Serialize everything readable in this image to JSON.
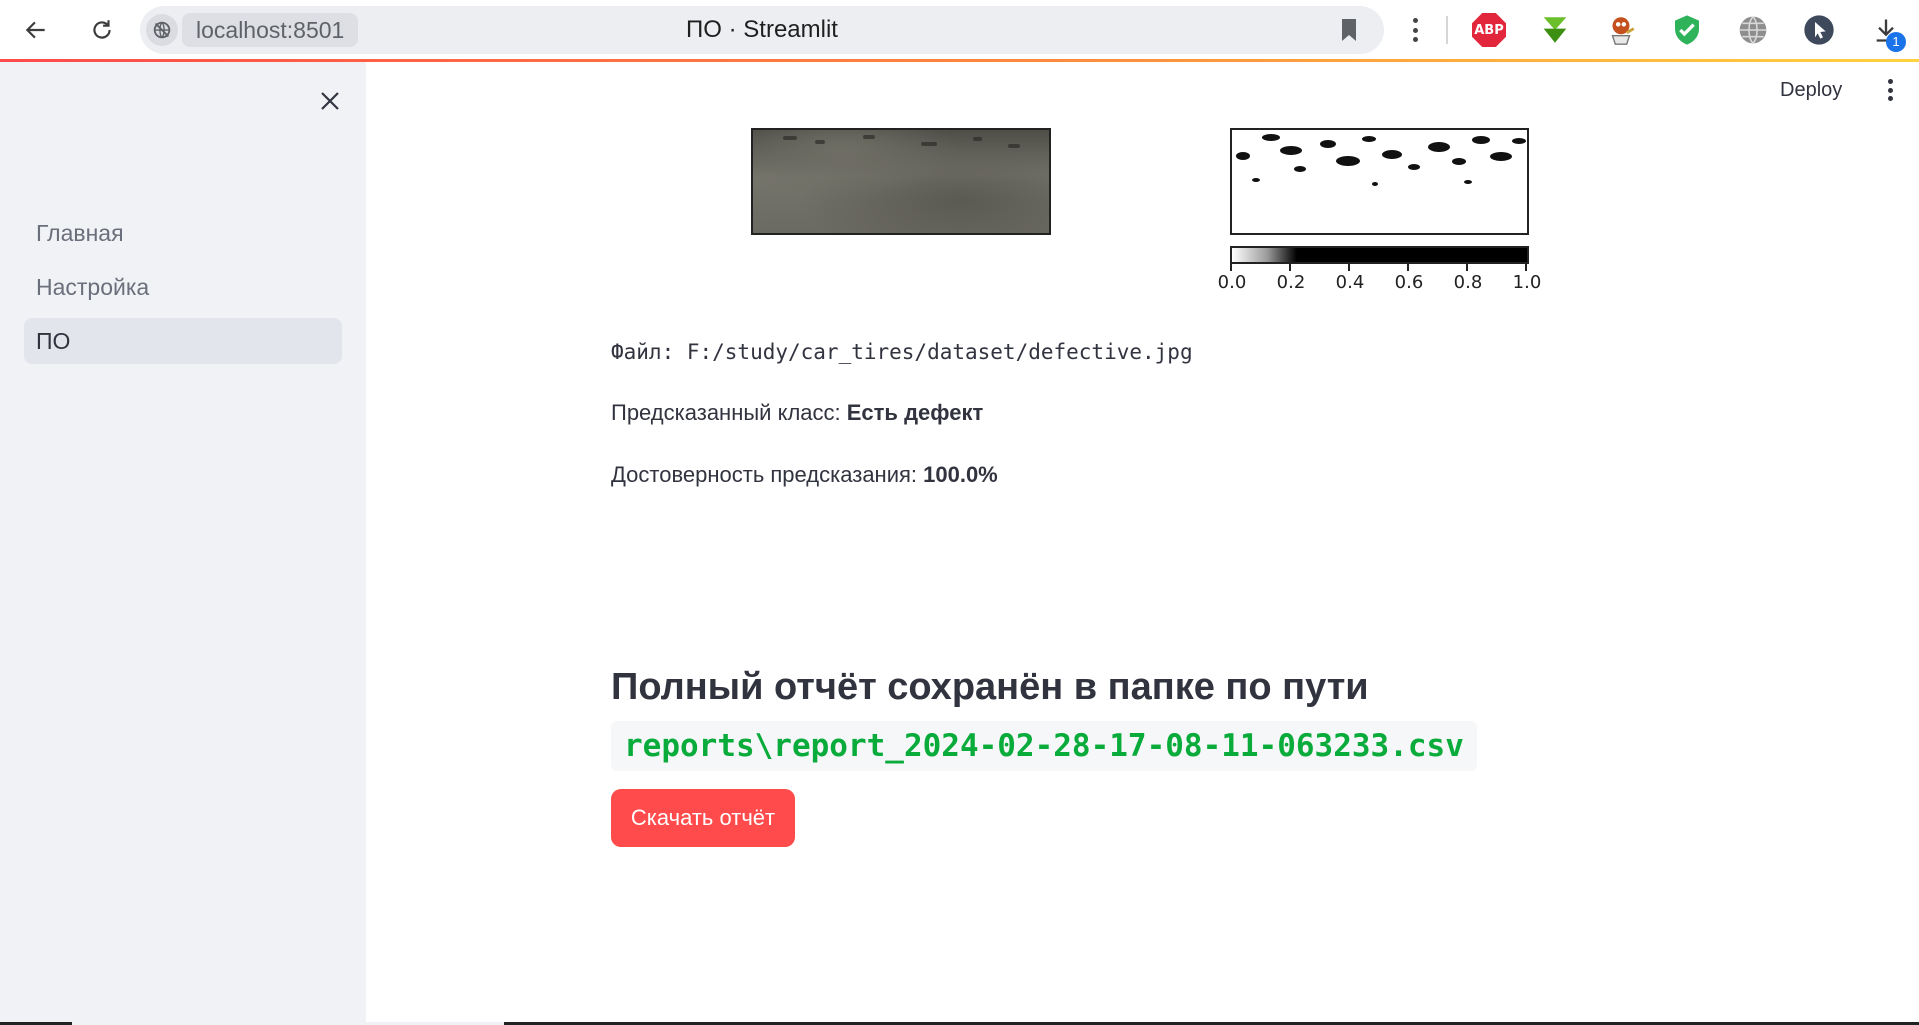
{
  "browser": {
    "url": "localhost:8501",
    "tab_title": "ПО · Streamlit",
    "extensions": [
      "adblock-plus",
      "download-helper",
      "mascot-extension",
      "shield-extension",
      "globe-extension",
      "cursor-extension",
      "downloads"
    ],
    "abp_label": "ABP",
    "downloads_badge": "1"
  },
  "sidebar": {
    "items": [
      {
        "label": "Главная",
        "active": false
      },
      {
        "label": "Настройка",
        "active": false
      },
      {
        "label": "ПО",
        "active": true
      }
    ]
  },
  "header": {
    "deploy_label": "Deploy"
  },
  "result": {
    "colorbar_ticks": [
      "0.0",
      "0.2",
      "0.4",
      "0.6",
      "0.8",
      "1.0"
    ],
    "file_label": "Файл: F:/study/car_tires/dataset/defective.jpg",
    "predicted_prefix": "Предсказанный класс: ",
    "predicted_value": "Есть дефект",
    "confidence_prefix": "Достоверность предсказания: ",
    "confidence_value": "100.0%"
  },
  "report": {
    "heading": "Полный отчёт сохранён в папке по пути",
    "path": "reports\\report_2024-02-28-17-08-11-063233.csv",
    "download_label": "Скачать отчёт"
  },
  "colors": {
    "accent": "#ff4b4b",
    "path_green": "#09ab3b",
    "sidebar_bg": "#f0f2f6"
  }
}
